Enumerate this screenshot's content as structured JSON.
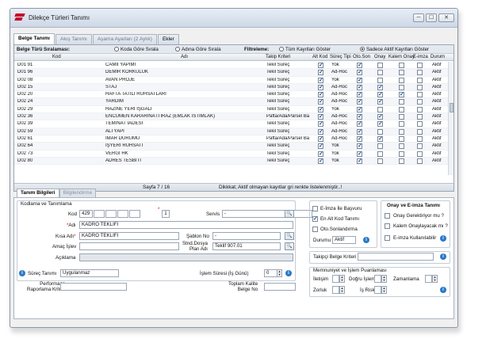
{
  "window": {
    "title": "Dilekçe Türleri Tanımı",
    "min": "─",
    "max": "☐",
    "close": "✕"
  },
  "tabs": [
    {
      "label": "Belge Tanımı"
    },
    {
      "label": "Akış Tanımı"
    },
    {
      "label": "Aşama Ayarları (2 Aylık)"
    },
    {
      "label": "Ekler"
    }
  ],
  "filter": {
    "order_label": "Belge Türü Sıralaması:",
    "opt1": "Koda Göre Sırala",
    "opt2": "Adına Göre Sırala",
    "filter_label": "Filtreleme:",
    "opt3": "Tüm Kayıtları Göster",
    "opt4": "Sadece Aktif Kayıtları Göster"
  },
  "columns": {
    "kod": "Kod",
    "adi": "Adı",
    "takip": "Takip Kriteri",
    "altkod": "Alt Kod",
    "surec": "Süreç Tipi",
    "otoson": "Oto.Son",
    "onay": "Onay",
    "kalem": "Kalem Onay",
    "eimza": "E-imza",
    "durum": "Durum"
  },
  "rows": [
    {
      "kod": "D01 91",
      "adi": "CAMİİ YAPIMI",
      "takip": "Tekil Süreç",
      "altkod": true,
      "surec": "Yok",
      "otoson": true,
      "onay": false,
      "kalem": false,
      "eimza": false,
      "durum": "Aktif"
    },
    {
      "kod": "D01 96",
      "adi": "DEMİR KORKULUK",
      "takip": "Tekil Süreç",
      "altkod": true,
      "surec": "Ad-Hoc",
      "otoson": true,
      "onay": false,
      "kalem": false,
      "eimza": false,
      "durum": "Aktif"
    },
    {
      "kod": "D02 08",
      "adi": "AVAN PROJE",
      "takip": "Tekil Süreç",
      "altkod": true,
      "surec": "Yok",
      "otoson": true,
      "onay": false,
      "kalem": false,
      "eimza": false,
      "durum": "Aktif"
    },
    {
      "kod": "D02 15",
      "adi": "STAJ",
      "takip": "Tekil Süreç",
      "altkod": true,
      "surec": "Ad-Hoc",
      "otoson": true,
      "onay": true,
      "kalem": false,
      "eimza": false,
      "durum": "Aktif"
    },
    {
      "kod": "D02 20",
      "adi": "HAFTA TATİLİ RUHSATLARI",
      "takip": "Tekil Süreç",
      "altkod": true,
      "surec": "Ad-Hoc",
      "otoson": true,
      "onay": true,
      "kalem": true,
      "eimza": false,
      "durum": "Aktif"
    },
    {
      "kod": "D02 24",
      "adi": "YARDIM",
      "takip": "Tekil Süreç",
      "altkod": true,
      "surec": "Ad-Hoc",
      "otoson": true,
      "onay": true,
      "kalem": false,
      "eimza": false,
      "durum": "Aktif"
    },
    {
      "kod": "D02 29",
      "adi": "HAZİNE YERİ İŞGALİ",
      "takip": "Tekil Süreç",
      "altkod": true,
      "surec": "Yok",
      "otoson": true,
      "onay": false,
      "kalem": false,
      "eimza": false,
      "durum": "Aktif"
    },
    {
      "kod": "D02 36",
      "adi": "ENCÜMEN KARARINA İTİRAZ (EMLAK İSTİMLAK)",
      "takip": "Pafta/Ada/Parsel Ba",
      "altkod": true,
      "surec": "Ad-Hoc",
      "otoson": true,
      "onay": true,
      "kalem": false,
      "eimza": false,
      "durum": "Aktif"
    },
    {
      "kod": "D02 39",
      "adi": "TEMİNAT İADESİ",
      "takip": "Tekil Süreç",
      "altkod": true,
      "surec": "Ad-Hoc",
      "otoson": true,
      "onay": true,
      "kalem": false,
      "eimza": false,
      "durum": "Aktif"
    },
    {
      "kod": "D02 59",
      "adi": "ALTYAPI",
      "takip": "Tekil Süreç",
      "altkod": true,
      "surec": "Ad-Hoc",
      "otoson": true,
      "onay": false,
      "kalem": false,
      "eimza": false,
      "durum": "Aktif"
    },
    {
      "kod": "D02 61",
      "adi": "İMAR DURUMU",
      "takip": "Pafta/Ada/Parsel Ba",
      "altkod": true,
      "surec": "Ad-Hoc",
      "otoson": true,
      "onay": true,
      "kalem": false,
      "eimza": false,
      "durum": "Aktif"
    },
    {
      "kod": "D02 64",
      "adi": "İŞYERİ RUHSATI",
      "takip": "Tekil Süreç",
      "altkod": true,
      "surec": "Yok",
      "otoson": true,
      "onay": false,
      "kalem": false,
      "eimza": false,
      "durum": "Aktif"
    },
    {
      "kod": "D02 73",
      "adi": "VERGİ HK",
      "takip": "Tekil Süreç",
      "altkod": true,
      "surec": "Yok",
      "otoson": true,
      "onay": false,
      "kalem": false,
      "eimza": false,
      "durum": "Aktif"
    },
    {
      "kod": "D02 80",
      "adi": "ADRES TESBİTİ",
      "takip": "Tekil Süreç",
      "altkod": true,
      "surec": "Yok",
      "otoson": true,
      "onay": false,
      "kalem": false,
      "eimza": false,
      "durum": "Aktif"
    }
  ],
  "pager": {
    "page": "Sayfa 7 / 16",
    "note": "Dikkkat; Aktif olmayan kayıtlar gri renkte listelenmiştir..!"
  },
  "subtabs": [
    {
      "label": "Tanım Bilgileri"
    },
    {
      "label": "Bilgilendirme"
    }
  ],
  "form": {
    "section": "Kodlama ve Tanımlama",
    "kod_label": "Kod",
    "kod_value": "429",
    "kod_num": "1",
    "servis_label": "Servis",
    "servis_value": "-",
    "adi_label": "Adı",
    "adi_value": "KADRO TEKLİFİ",
    "kisa_label": "Kısa Adı",
    "kisa_value": "KADRO TEKLİFİ",
    "sablon_label": "Şablon No",
    "sablon_value": "-",
    "amac_label": "Amaç İşlev",
    "stnd_label1": "Stnd.Dosya",
    "stnd_label2": "Plan Adı",
    "stnd_value": "Teklif  907.01",
    "aciklama_label": "Açıklama",
    "surec_label": "Süreç Tanımı",
    "surec_value": "Uygulanmaz",
    "islem_label": "İşlem Süresi (İş Günü)",
    "islem_value": "0",
    "perf_label1": "Performans",
    "perf_label2": "Raporlama Kriteri",
    "toplam_label1": "Toplam Kalite",
    "toplam_label2": "Belge No",
    "chk_eimza": "E-İmza İle Başvuru",
    "chk_enalt": "En Alt Kod Tanımı",
    "chk_oto": "Oto.Sonlandırma",
    "durum_label": "Durumu",
    "durum_value": "Aktif",
    "onay_title": "Onay ve E-imza Tanımı",
    "onay_gerek": "Onay Gerektiriyor mu ?",
    "kalem_onay": "Kalem Onaylayacak mı ?",
    "eimza_kull": "E-imza Kullanılabilir",
    "takipci_label": "Takipçi Belge Kriteri",
    "memnun_title": "Memnuniyet ve İşlem Puanlaması",
    "iletisim": "İletişim",
    "dogru": "Doğru İşlem",
    "zamanlama": "Zamanlama",
    "zorluk": "Zorluk",
    "isriski": "İş Riski",
    "search_icon": "🔍"
  }
}
